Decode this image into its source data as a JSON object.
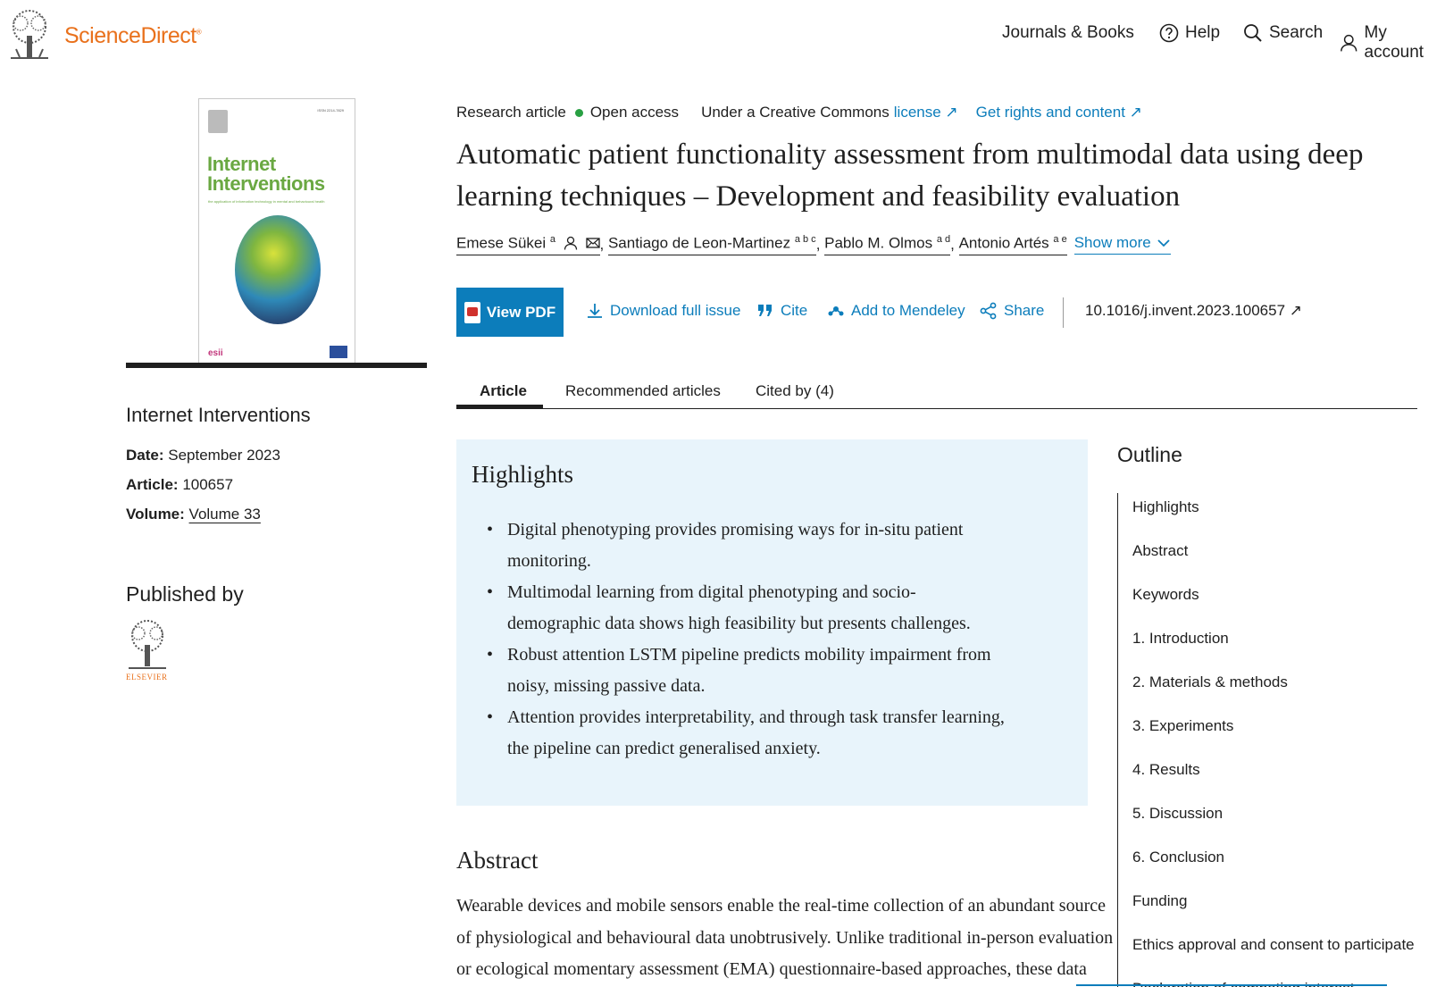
{
  "header": {
    "logo_text": "ScienceDirect",
    "logo_mark": "®",
    "nav": {
      "journals_books": "Journals & Books",
      "help": "Help",
      "search": "Search",
      "my_account": "My account"
    }
  },
  "sidebar": {
    "cover": {
      "title_line1": "Internet",
      "title_line2": "Interventions",
      "subtitle": "the application of information technology in mental and behavioural health",
      "footer_mark": "esii",
      "footer_mark2": "ISRI",
      "issn": "ISSN 2214-7829"
    },
    "journal_name": "Internet Interventions",
    "date_label": "Date:",
    "date_value": "September 2023",
    "article_label": "Article:",
    "article_value": "100657",
    "volume_label": "Volume:",
    "volume_value": "Volume 33",
    "published_by": "Published by",
    "publisher_text": "ELSEVIER"
  },
  "article": {
    "type": "Research article",
    "access": "Open access",
    "license_prefix": "Under a Creative Commons",
    "license_link": "license ↗",
    "rights_link": "Get rights and content ↗",
    "title": "Automatic patient functionality assessment from multimodal data using deep learning techniques – Development and feasibility evaluation",
    "authors": [
      {
        "name": "Emese Sükei",
        "sup": "a"
      },
      {
        "name": "Santiago de Leon-Martinez",
        "sup": "a b c"
      },
      {
        "name": "Pablo M. Olmos",
        "sup": "a d"
      },
      {
        "name": "Antonio Artés",
        "sup": "a e"
      }
    ],
    "show_more": "Show more",
    "actions": {
      "view_pdf": "View PDF",
      "download": "Download full issue",
      "cite": "Cite",
      "mendeley": "Add to Mendeley",
      "share": "Share",
      "doi": "10.1016/j.invent.2023.100657 ↗"
    },
    "tabs": [
      "Article",
      "Recommended articles",
      "Cited by (4)"
    ]
  },
  "highlights": {
    "title": "Highlights",
    "items": [
      "Digital phenotyping provides promising ways for in-situ patient monitoring.",
      "Multimodal learning from digital phenotyping and socio-demographic data shows high feasibility but presents challenges.",
      "Robust attention LSTM pipeline predicts mobility impairment from noisy, missing passive data.",
      "Attention provides interpretability, and through task transfer learning, the pipeline can predict generalised anxiety."
    ]
  },
  "abstract": {
    "title": "Abstract",
    "lines": [
      "Wearable devices and mobile sensors enable the real-time collection of an abundant source",
      "of physiological and behavioural data unobtrusively. Unlike traditional in-person evaluation",
      "or ecological momentary assessment (EMA) questionnaire-based approaches, these data"
    ]
  },
  "outline": {
    "title": "Outline",
    "items": [
      "Highlights",
      "Abstract",
      "Keywords",
      "1. Introduction",
      "2. Materials & methods",
      "3. Experiments",
      "4. Results",
      "5. Discussion",
      "6. Conclusion",
      "Funding",
      "Ethics approval and consent to participate",
      "Declaration of competing interest"
    ]
  },
  "colors": {
    "brand_orange": "#e9711c",
    "link_blue": "#0c7dbb",
    "highlight_bg": "#e8f4fb",
    "open_access_green": "#29a043"
  }
}
